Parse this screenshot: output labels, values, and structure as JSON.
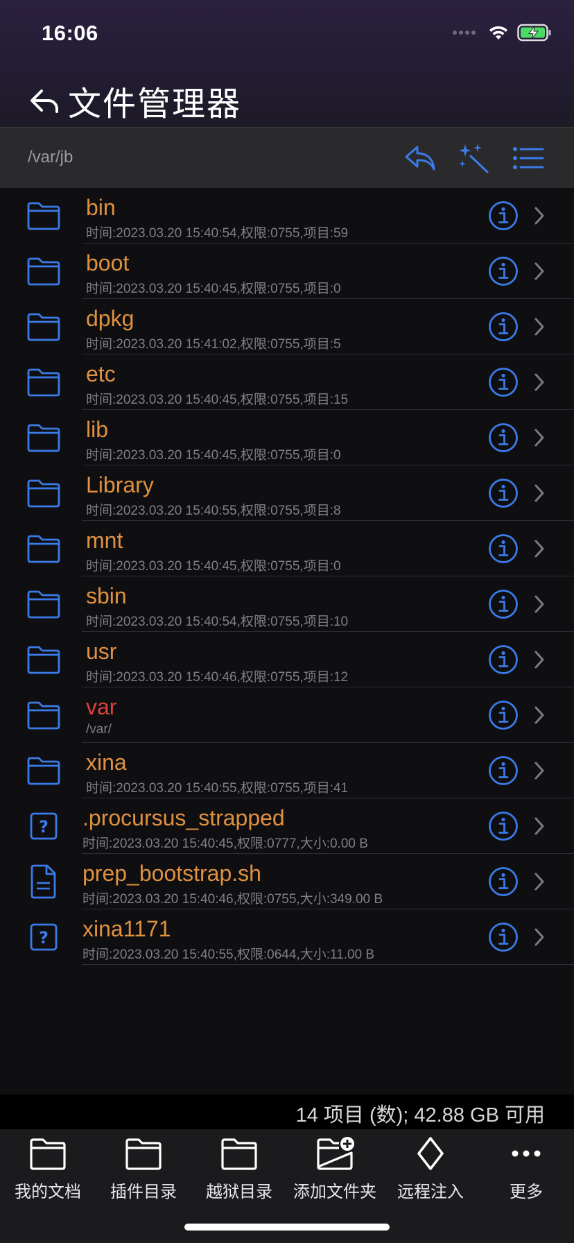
{
  "status_bar": {
    "time": "16:06"
  },
  "nav": {
    "title": "文件管理器",
    "back_icon": "back-arrow-icon"
  },
  "path_bar": {
    "path": "/var/jb",
    "tools": [
      "reply-back-icon",
      "magic-wand-icon",
      "list-icon"
    ]
  },
  "colors": {
    "accent": "#3b7be8",
    "name_orange": "#e0913f",
    "name_red": "#d8423a",
    "meta_gray": "#7f7f86"
  },
  "files": [
    {
      "name": "bin",
      "meta": "时间:2023.03.20 15:40:54,权限:0755,项目:59",
      "type": "folder"
    },
    {
      "name": "boot",
      "meta": "时间:2023.03.20 15:40:45,权限:0755,项目:0",
      "type": "folder"
    },
    {
      "name": "dpkg",
      "meta": "时间:2023.03.20 15:41:02,权限:0755,项目:5",
      "type": "folder"
    },
    {
      "name": "etc",
      "meta": "时间:2023.03.20 15:40:45,权限:0755,项目:15",
      "type": "folder"
    },
    {
      "name": "lib",
      "meta": "时间:2023.03.20 15:40:45,权限:0755,项目:0",
      "type": "folder"
    },
    {
      "name": "Library",
      "meta": "时间:2023.03.20 15:40:55,权限:0755,项目:8",
      "type": "folder"
    },
    {
      "name": "mnt",
      "meta": "时间:2023.03.20 15:40:45,权限:0755,项目:0",
      "type": "folder"
    },
    {
      "name": "sbin",
      "meta": "时间:2023.03.20 15:40:54,权限:0755,项目:10",
      "type": "folder"
    },
    {
      "name": "usr",
      "meta": "时间:2023.03.20 15:40:46,权限:0755,项目:12",
      "type": "folder"
    },
    {
      "name": "var",
      "meta": "/var/",
      "type": "folder",
      "symlink": true
    },
    {
      "name": "xina",
      "meta": "时间:2023.03.20 15:40:55,权限:0755,项目:41",
      "type": "folder"
    },
    {
      "name": ".procursus_strapped",
      "meta": "时间:2023.03.20 15:40:45,权限:0777,大小:0.00 B",
      "type": "unknown"
    },
    {
      "name": "prep_bootstrap.sh",
      "meta": "时间:2023.03.20 15:40:46,权限:0755,大小:349.00 B",
      "type": "document"
    },
    {
      "name": "xina1171",
      "meta": "时间:2023.03.20 15:40:55,权限:0644,大小:11.00 B",
      "type": "unknown"
    }
  ],
  "summary": "14 项目 (数); 42.88 GB 可用",
  "tabs": [
    {
      "label": "我的文档",
      "icon": "folder-icon"
    },
    {
      "label": "插件目录",
      "icon": "folder-icon"
    },
    {
      "label": "越狱目录",
      "icon": "folder-icon"
    },
    {
      "label": "添加文件夹",
      "icon": "folder-add-icon"
    },
    {
      "label": "远程注入",
      "icon": "diamond-icon"
    },
    {
      "label": "更多",
      "icon": "more-dots-icon"
    }
  ]
}
